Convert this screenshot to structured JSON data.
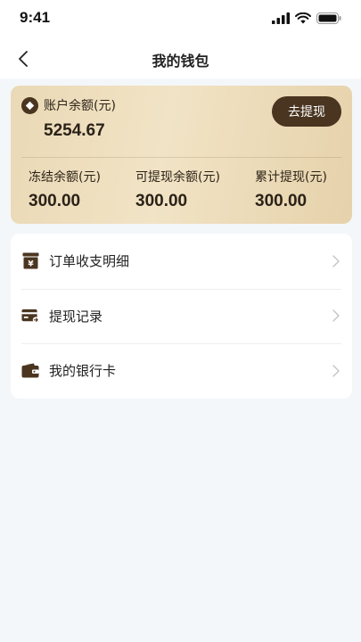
{
  "status_bar": {
    "time": "9:41"
  },
  "nav": {
    "title": "我的钱包"
  },
  "wallet": {
    "balance_label": "账户余额(元)",
    "balance_value": "5254.67",
    "withdraw_label": "去提现",
    "stats": [
      {
        "label": "冻结余额(元)",
        "value": "300.00"
      },
      {
        "label": "可提现余额(元)",
        "value": "300.00"
      },
      {
        "label": "累计提现(元)",
        "value": "300.00"
      }
    ]
  },
  "menu": {
    "items": [
      {
        "label": "订单收支明细",
        "icon": "order-ledger-icon"
      },
      {
        "label": "提现记录",
        "icon": "withdraw-card-icon"
      },
      {
        "label": "我的银行卡",
        "icon": "wallet-icon"
      }
    ]
  },
  "colors": {
    "accent_dark": "#4a3520",
    "card_gold": "#ecdcbb",
    "page_bg": "#f4f7f9"
  }
}
